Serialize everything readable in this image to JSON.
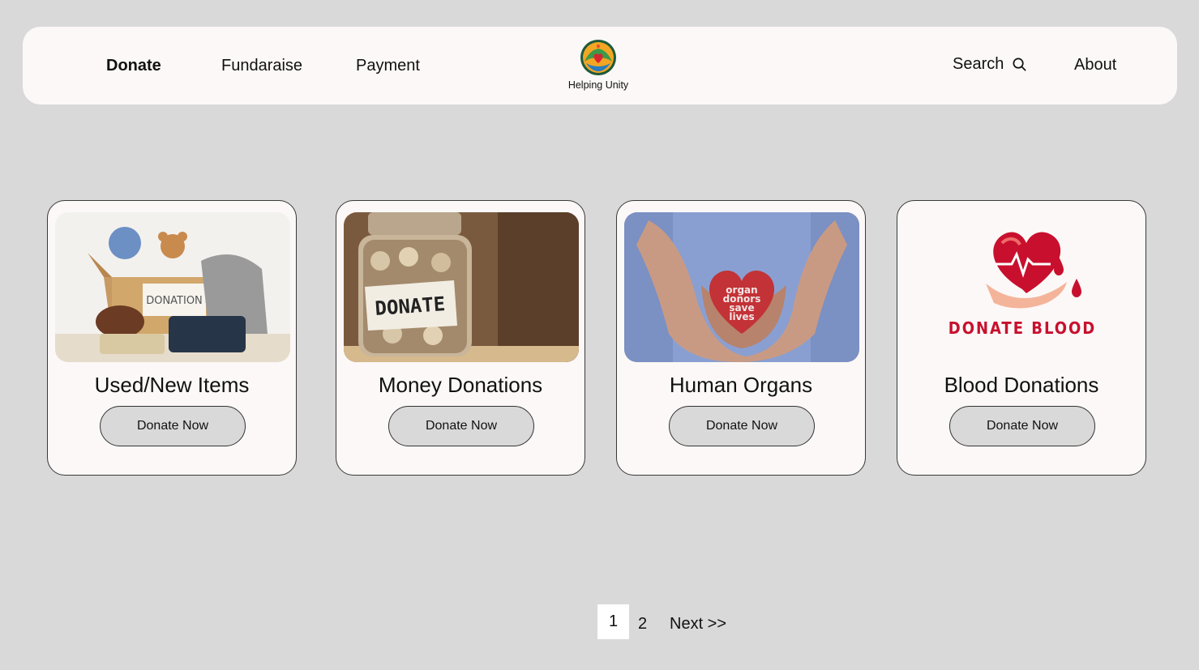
{
  "nav": {
    "links": [
      {
        "label": "Donate",
        "active": true
      },
      {
        "label": "Fundaraise",
        "active": false
      },
      {
        "label": "Payment",
        "active": false
      }
    ],
    "brand": "Helping Unity",
    "search_label": "Search",
    "about_label": "About"
  },
  "cards": [
    {
      "title": "Used/New Items",
      "image_label": "DONATION",
      "icon": "donation-box-image",
      "button_label": "Donate Now"
    },
    {
      "title": "Money Donations",
      "image_label": "DONATE",
      "icon": "coin-jar-image",
      "button_label": "Donate Now"
    },
    {
      "title": "Human Organs",
      "image_label": "organ donors save lives",
      "icon": "hands-heart-image",
      "button_label": "Donate Now"
    },
    {
      "title": "Blood Donations",
      "image_label": "DONATE BLOOD",
      "icon": "blood-heart-image",
      "button_label": "Donate Now"
    }
  ],
  "pagination": {
    "current": "1",
    "page2": "2",
    "next_label": "Next >>"
  },
  "colors": {
    "background": "#d9d9d9",
    "surface": "#fcf8f7",
    "blood_red": "#c8102e"
  }
}
